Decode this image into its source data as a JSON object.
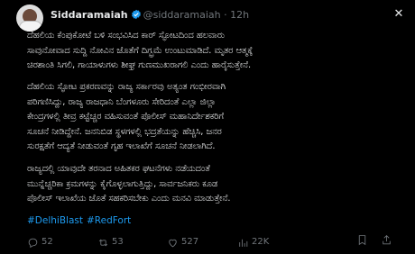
{
  "author": {
    "name": "Siddaramaiah",
    "handle": "@siddaramaiah",
    "separator": "·",
    "time": "12h"
  },
  "body": {
    "paragraph1": [
      "ದೆಹಲಿಯ ಕೆಂಪುಕೋಟೆ ಬಳಿ ಸಂಭವಿಸಿದ ಕಾರ್ ಸ್ಫೋಟದಿಂದ ಹಲವಾರು",
      "ಸಾವುನೋವಾದ ಸುದ್ದಿ ನೋವಿನ ಜೊತೆಗೆ ದಿಗ್ಭ್ರಮೆ ಉಂಟುಮಾಡಿದೆ. ಮೃತರ ಆತ್ಮಕ್ಕೆ",
      "ಚಿರಶಾಂತಿ ಸಿಗಲಿ, ಗಾಯಾಳುಗಳು ಶೀಘ್ರ ಗುಣಮುಖರಾಗಲಿ ಎಂದು ಹಾರೈಸುತ್ತೇನೆ."
    ],
    "paragraph2": [
      "ದೆಹಲಿಯ ಸ್ಫೋಟ ಪ್ರಕರಣವನ್ನು ರಾಜ್ಯ ಸರ್ಕಾರವು ಅತ್ಯಂತ ಗಂಭೀರವಾಗಿ",
      "ಪರಿಗಣಿಸಿದ್ದು, ರಾಜ್ಯ ರಾಜಧಾನಿ ಬೆಂಗಳೂರು ಸೇರಿದಂತೆ ಎಲ್ಲಾ ಜಿಲ್ಲಾ",
      "ಕೇಂದ್ರಗಳಲ್ಲಿ ತೀವ್ರ ಕಟ್ಟೆಚ್ಚರ ವಹಿಸುವಂತೆ ಪೊಲೀಸ್ ಮಹಾನಿರ್ದೇಶಕರಿಗೆ",
      "ಸೂಚನೆ ನೀಡಿದ್ದೇನೆ. ಜನನಿಬಿಡ ಸ್ಥಳಗಳಲ್ಲಿ ಭದ್ರತೆಯನ್ನು ಹೆಚ್ಚಿಸಿ, ಜನರ",
      "ಸುರಕ್ಷತೆಗೆ ಆದ್ಯತೆ ನೀಡುವಂತೆ ಗೃಹ ಇಲಾಖೆಗೆ ಸೂಚನೆ ನೀಡಲಾಗಿದೆ."
    ],
    "paragraph3": [
      "ರಾಜ್ಯದಲ್ಲಿ ಯಾವುದೇ ತರನಾದ ಅಹಿತಕರ ಘಟನೆಗಳು ನಡೆಯದಂತೆ",
      "ಮುನ್ನೆಚ್ಚರಿಕಾ ಕ್ರಮಗಳನ್ನು ಕೈಗೊಳ್ಳಲಾಗುತ್ತಿದ್ದು, ಸಾರ್ವಜನಿಕರು ಕೂಡ",
      "ಪೊಲೀಸ್ ಇಲಾಖೆಯ ಜೊತೆ ಸಹಕರಿಸಬೇಕು ಎಂದು ಮನವಿ ಮಾಡುತ್ತೇನೆ."
    ]
  },
  "hashtags": [
    "#DelhiBlast",
    "#RedFort"
  ],
  "actions": {
    "reply_count": "52",
    "repost_count": "53",
    "like_count": "527",
    "views_count": "22K"
  },
  "icons": {
    "close": "close-icon",
    "reply": "reply-icon",
    "repost": "repost-icon",
    "like": "heart-icon",
    "views": "views-icon",
    "bookmark": "bookmark-icon",
    "share": "share-icon"
  },
  "colors": {
    "background": "#000000",
    "text": "#e7e9ea",
    "muted": "#71767b",
    "link": "#1d9bf0",
    "verified": "#1d9bf0"
  }
}
